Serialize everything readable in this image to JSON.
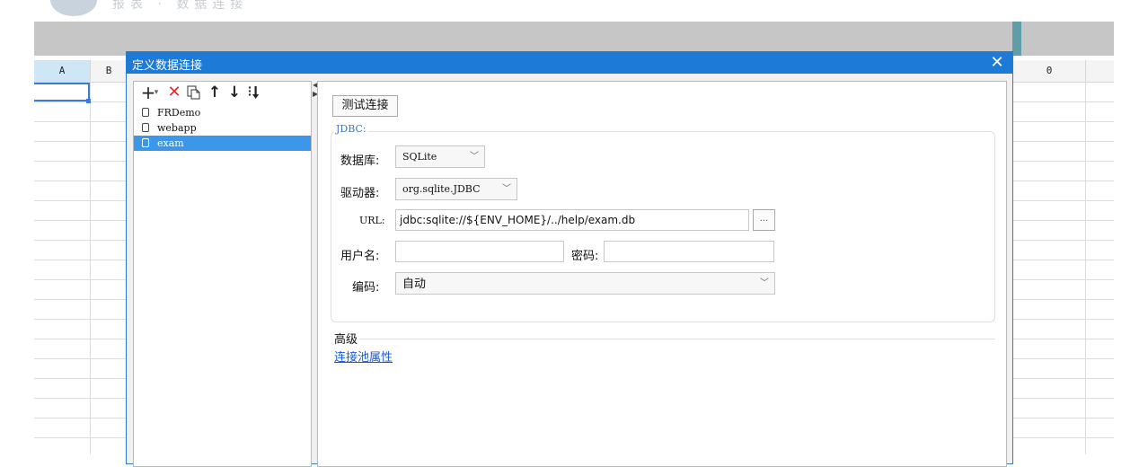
{
  "background": {
    "banner_text": "报表 · 数据连接"
  },
  "sheet": {
    "columns": [
      {
        "label": "A"
      },
      {
        "label": "B"
      },
      {
        "label": "0"
      }
    ]
  },
  "dialog": {
    "title": "定义数据连接",
    "close_label": "✕",
    "toolbar": {
      "add_label": "+",
      "add_dropdown": "▾",
      "delete_label": "✕",
      "up_label": "↑",
      "down_label": "↓"
    },
    "connections": [
      {
        "name": "FRDemo",
        "selected": false
      },
      {
        "name": "webapp",
        "selected": false
      },
      {
        "name": "exam",
        "selected": true
      }
    ],
    "test_button": "测试连接",
    "jdbc_group": "JDBC:",
    "fields": {
      "database_label": "数据库:",
      "database_value": "SQLite",
      "driver_label": "驱动器:",
      "driver_value": "org.sqlite.JDBC",
      "url_label": "URL:",
      "url_value": "jdbc:sqlite://${ENV_HOME}/../help/exam.db",
      "url_browse": "...",
      "username_label": "用户名:",
      "username_value": "",
      "password_label": "密码:",
      "password_value": "",
      "encoding_label": "编码:",
      "encoding_value": "自动"
    },
    "advanced": {
      "title": "高级",
      "link": "连接池属性"
    }
  },
  "colors": {
    "title_bar": "#1d7bd7",
    "selection": "#3c97e8",
    "link": "#1a5ad8"
  }
}
